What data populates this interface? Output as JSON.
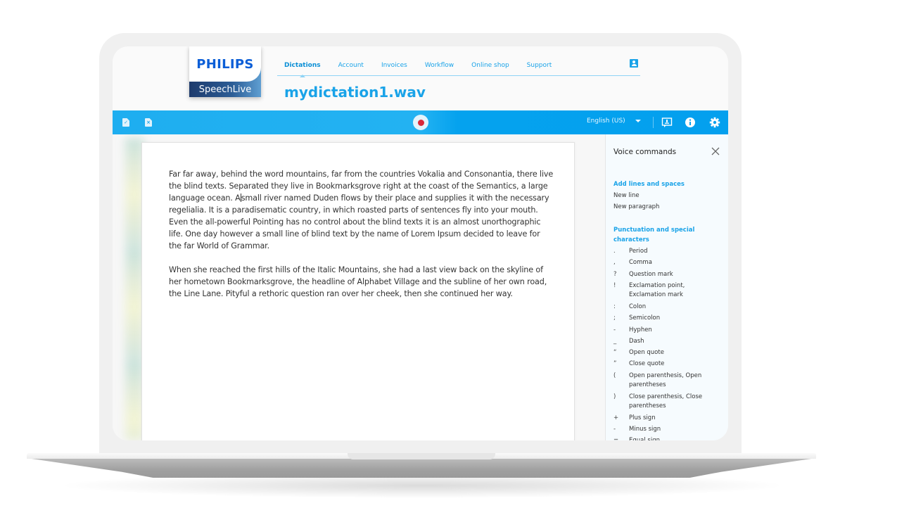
{
  "brand": {
    "company": "PHILIPS",
    "product": "SpeechLive"
  },
  "nav": {
    "items": [
      {
        "label": "Dictations",
        "active": true
      },
      {
        "label": "Account",
        "active": false
      },
      {
        "label": "Invoices",
        "active": false
      },
      {
        "label": "Workflow",
        "active": false
      },
      {
        "label": "Online shop",
        "active": false
      },
      {
        "label": "Support",
        "active": false
      }
    ],
    "profile_icon": "user-profile-icon"
  },
  "document": {
    "title": "mydictation1.wav",
    "paragraphs": [
      {
        "before_caret": "Far far away, behind the word mountains, far from the countries Vokalia and Consonantia, there live the blind texts. Separated they live in Bookmarksgrove right at the coast of the Semantics, a large language ocean. A",
        "after_caret": "small river named Duden flows by their place and supplies it with the necessary regelialia. It is a paradisematic country, in which roasted parts of sentences fly into your mouth. Even the all-powerful Pointing has no control about the blind texts it is an almost unorthographic life. One day however a small line of blind text by the name of Lorem Ipsum decided to leave for the far World of Grammar."
      },
      {
        "text": "When she reached the first hills of the Italic Mountains, she had a last view back on the skyline of her hometown Bookmarksgrove, the headline of Alphabet Village and the subline of her own road, the Line Lane. Pityful a rethoric question ran over her cheek, then she continued her way."
      }
    ]
  },
  "toolbar": {
    "left_icons": [
      "file-check-icon",
      "file-close-icon"
    ],
    "record_icon": "record-icon",
    "language": "English (US)",
    "right_icons": [
      "voice-commands-icon",
      "info-icon",
      "settings-gear-icon"
    ]
  },
  "voice_commands": {
    "title": "Voice commands",
    "sections": [
      {
        "heading": "Add lines and spaces",
        "commands": [
          "New line",
          "New paragraph"
        ]
      },
      {
        "heading": "Punctuation and special characters",
        "commands": [
          {
            "symbol": ".",
            "label": "Period"
          },
          {
            "symbol": ",",
            "label": "Comma"
          },
          {
            "symbol": "?",
            "label": "Question mark"
          },
          {
            "symbol": "!",
            "label": "Exclamation point, Exclamation mark"
          },
          {
            "symbol": ":",
            "label": "Colon"
          },
          {
            "symbol": ";",
            "label": "Semicolon"
          },
          {
            "symbol": "-",
            "label": "Hyphen"
          },
          {
            "symbol": "_",
            "label": "Dash"
          },
          {
            "symbol": "“",
            "label": "Open quote"
          },
          {
            "symbol": "”",
            "label": "Close quote"
          },
          {
            "symbol": "(",
            "label": "Open parenthesis, Open parentheses"
          },
          {
            "symbol": ")",
            "label": "Close parenthesis, Close parentheses"
          },
          {
            "symbol": "+",
            "label": "Plus sign"
          },
          {
            "symbol": "-",
            "label": "Minus sign"
          },
          {
            "symbol": "=",
            "label": "Equal sign"
          }
        ]
      }
    ]
  },
  "colors": {
    "accent": "#1aa3e8",
    "toolbar": "#04a0ee",
    "brand_blue": "#0b5ed7",
    "brand_dark": "#1d3a6c",
    "record": "#d9283a"
  }
}
